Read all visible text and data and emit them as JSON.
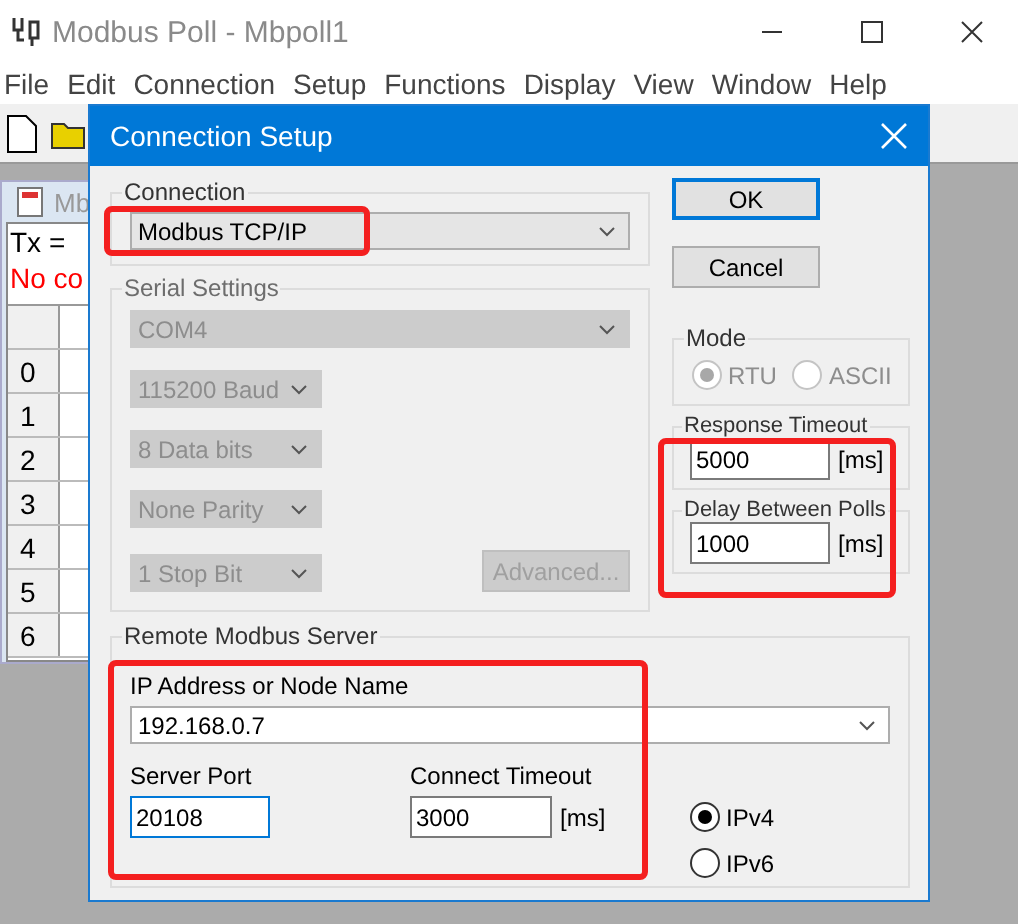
{
  "main_window": {
    "title": "Modbus Poll - Mbpoll1"
  },
  "menu": [
    {
      "label": "File"
    },
    {
      "label": "Edit"
    },
    {
      "label": "Connection"
    },
    {
      "label": "Setup"
    },
    {
      "label": "Functions"
    },
    {
      "label": "Display"
    },
    {
      "label": "View"
    },
    {
      "label": "Window"
    },
    {
      "label": "Help"
    }
  ],
  "child_window": {
    "title": "Mb",
    "status_lines": [
      {
        "text": "Tx =",
        "kind": "normal"
      },
      {
        "text": "No co",
        "kind": "error"
      }
    ],
    "row_numbers": [
      "0",
      "1",
      "2",
      "3",
      "4",
      "5",
      "6"
    ]
  },
  "dialog": {
    "title": "Connection Setup",
    "connection": {
      "label": "Connection",
      "value": "Modbus TCP/IP",
      "highlighted": true
    },
    "buttons": [
      {
        "label": "OK",
        "default": true
      },
      {
        "label": "Cancel",
        "default": false
      }
    ],
    "serial_settings": {
      "label": "Serial Settings",
      "disabled": true,
      "port": "COM4",
      "options": [
        "115200 Baud",
        "8 Data bits",
        "None Parity",
        "1 Stop Bit"
      ],
      "advanced_button": "Advanced..."
    },
    "mode": {
      "label": "Mode",
      "disabled": true,
      "options": [
        {
          "label": "RTU",
          "selected": true
        },
        {
          "label": "ASCII",
          "selected": false
        }
      ]
    },
    "timing": {
      "highlighted": true,
      "fields": [
        {
          "label": "Response Timeout",
          "value": "5000",
          "unit": "[ms]"
        },
        {
          "label": "Delay Between Polls",
          "value": "1000",
          "unit": "[ms]"
        }
      ]
    },
    "remote_server": {
      "label": "Remote Modbus Server",
      "highlighted": true,
      "address": {
        "label": "IP Address or Node Name",
        "value": "192.168.0.7"
      },
      "port": {
        "label": "Server Port",
        "value": "20108",
        "focused": true
      },
      "connect_timeout": {
        "label": "Connect Timeout",
        "value": "3000",
        "unit": "[ms]"
      },
      "ip_version": [
        {
          "label": "IPv4",
          "selected": true
        },
        {
          "label": "IPv6",
          "selected": false
        }
      ]
    }
  }
}
